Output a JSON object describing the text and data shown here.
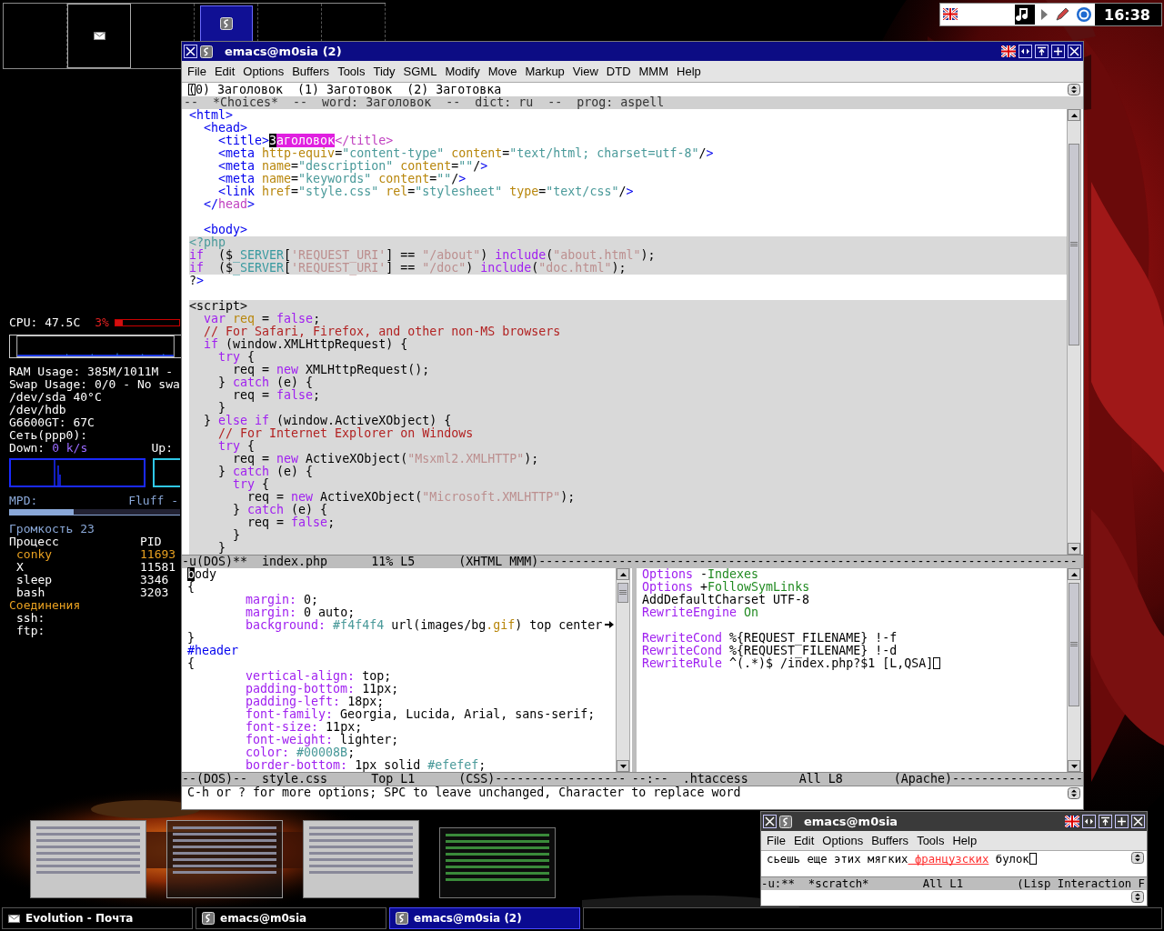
{
  "pager": [
    {
      "kind": "empty"
    },
    {
      "kind": "mail"
    },
    {
      "kind": "empty"
    },
    {
      "kind": "emacs"
    },
    {
      "kind": "empty"
    },
    {
      "kind": "empty"
    }
  ],
  "tray": {
    "clock": "16:38"
  },
  "conky": {
    "cpu": {
      "label": "CPU: 47.5C",
      "usage": "3%",
      "level": 0.12
    },
    "stats": [
      "RAM Usage: 385M/1011M -",
      "Swap Usage: 0/0 - No swa",
      "/dev/sda 40°C",
      "/dev/hdb",
      "G6600GT: 67C",
      "Сеть(ppp0):"
    ],
    "net": {
      "down_label": "Down:",
      "down": "0 k/s",
      "up_label": "Up:"
    },
    "mpd": {
      "label": "MPD:",
      "track": "Fluff -",
      "level": 0.38
    },
    "volume": "Громкость 23",
    "process_headers": [
      "Процесс",
      "PID"
    ],
    "processes": [
      {
        "name": "conky",
        "pid": "11693",
        "highlighted": true
      },
      {
        "name": "X",
        "pid": "11581",
        "highlighted": false
      },
      {
        "name": "sleep",
        "pid": "3346",
        "highlighted": false
      },
      {
        "name": "bash",
        "pid": "3203",
        "highlighted": false
      }
    ],
    "connections_title": "Соединения",
    "connections": [
      "ssh:",
      "ftp:"
    ]
  },
  "main_window": {
    "title": "emacs@m0sia (2)",
    "menu": [
      "File",
      "Edit",
      "Options",
      "Buffers",
      "Tools",
      "Tidy",
      "SGML",
      "Modify",
      "Move",
      "Markup",
      "View",
      "DTD",
      "MMM",
      "Help"
    ],
    "choices": [
      "(0) Заголовок",
      "(1) Заготовок",
      "(2) Заготовка"
    ],
    "header_line": "--  *Choices*  --  word: Заголовок  --  dict: ru  --  prog: aspell",
    "buffer": [
      {
        "kind": "code",
        "highlighted": false,
        "segments": [
          {
            "kind": "tag",
            "text": "<html>"
          }
        ]
      },
      {
        "kind": "code",
        "highlighted": false,
        "segments": [
          {
            "kind": "tag",
            "text": "  <head>"
          }
        ]
      },
      {
        "kind": "code",
        "highlighted": false,
        "segments": [
          {
            "kind": "tag",
            "text": "    <title>"
          },
          {
            "kind": "cursor",
            "text": "З"
          },
          {
            "kind": "match",
            "text": "аголовок"
          },
          {
            "kind": "close",
            "text": "</title>"
          }
        ]
      },
      {
        "kind": "code",
        "highlighted": false,
        "segments": [
          {
            "kind": "tag",
            "text": "    <meta"
          },
          {
            "kind": "attr",
            "text": " http-equiv"
          },
          {
            "kind": "plain",
            "text": "="
          },
          {
            "kind": "value",
            "text": "\"content-type\""
          },
          {
            "kind": "attr",
            "text": " content"
          },
          {
            "kind": "plain",
            "text": "="
          },
          {
            "kind": "value",
            "text": "\"text/html; charset=utf-8\""
          },
          {
            "kind": "plain",
            "text": "/"
          },
          {
            "kind": "tag",
            "text": ">"
          }
        ]
      },
      {
        "kind": "code",
        "highlighted": false,
        "segments": [
          {
            "kind": "tag",
            "text": "    <meta"
          },
          {
            "kind": "attr",
            "text": " name"
          },
          {
            "kind": "plain",
            "text": "="
          },
          {
            "kind": "value",
            "text": "\"description\""
          },
          {
            "kind": "attr",
            "text": " content"
          },
          {
            "kind": "plain",
            "text": "="
          },
          {
            "kind": "value",
            "text": "\"\""
          },
          {
            "kind": "plain",
            "text": "/"
          },
          {
            "kind": "tag",
            "text": ">"
          }
        ]
      },
      {
        "kind": "code",
        "highlighted": false,
        "segments": [
          {
            "kind": "tag",
            "text": "    <meta"
          },
          {
            "kind": "attr",
            "text": " name"
          },
          {
            "kind": "plain",
            "text": "="
          },
          {
            "kind": "value",
            "text": "\"keywords\""
          },
          {
            "kind": "attr",
            "text": " content"
          },
          {
            "kind": "plain",
            "text": "="
          },
          {
            "kind": "value",
            "text": "\"\""
          },
          {
            "kind": "plain",
            "text": "/"
          },
          {
            "kind": "tag",
            "text": ">"
          }
        ]
      },
      {
        "kind": "code",
        "highlighted": false,
        "segments": [
          {
            "kind": "tag",
            "text": "    <link"
          },
          {
            "kind": "attr",
            "text": " href"
          },
          {
            "kind": "plain",
            "text": "="
          },
          {
            "kind": "value",
            "text": "\"style.css\""
          },
          {
            "kind": "attr",
            "text": " rel"
          },
          {
            "kind": "plain",
            "text": "="
          },
          {
            "kind": "value",
            "text": "\"stylesheet\""
          },
          {
            "kind": "attr",
            "text": " type"
          },
          {
            "kind": "plain",
            "text": "="
          },
          {
            "kind": "value",
            "text": "\"text/css\""
          },
          {
            "kind": "plain",
            "text": "/"
          },
          {
            "kind": "tag",
            "text": ">"
          }
        ]
      },
      {
        "kind": "code",
        "highlighted": false,
        "segments": [
          {
            "kind": "tag",
            "text": "  </"
          },
          {
            "kind": "close",
            "text": "head"
          },
          {
            "kind": "tag",
            "text": ">"
          }
        ]
      },
      {
        "kind": "blank"
      },
      {
        "kind": "code",
        "highlighted": false,
        "segments": [
          {
            "kind": "tag",
            "text": "  <body>"
          }
        ]
      },
      {
        "kind": "code",
        "highlighted": true,
        "segments": [
          {
            "kind": "value",
            "text": "<?php"
          }
        ]
      },
      {
        "kind": "code",
        "highlighted": true,
        "segments": [
          {
            "kind": "keyword",
            "text": "if"
          },
          {
            "kind": "plain",
            "text": "  ($"
          },
          {
            "kind": "var",
            "text": "_SERVER"
          },
          {
            "kind": "plain",
            "text": "["
          },
          {
            "kind": "str",
            "text": "'REQUEST_URI'"
          },
          {
            "kind": "plain",
            "text": "] == "
          },
          {
            "kind": "str",
            "text": "\"/about\""
          },
          {
            "kind": "plain",
            "text": ")"
          },
          {
            "kind": "keyword",
            "text": " include"
          },
          {
            "kind": "plain",
            "text": "("
          },
          {
            "kind": "str",
            "text": "\"about.html\""
          },
          {
            "kind": "plain",
            "text": ");"
          }
        ]
      },
      {
        "kind": "code",
        "highlighted": true,
        "segments": [
          {
            "kind": "keyword",
            "text": "if"
          },
          {
            "kind": "plain",
            "text": "  ($"
          },
          {
            "kind": "var",
            "text": "_SERVER"
          },
          {
            "kind": "plain",
            "text": "["
          },
          {
            "kind": "str",
            "text": "'REQUEST_URI'"
          },
          {
            "kind": "plain",
            "text": "] == "
          },
          {
            "kind": "str",
            "text": "\"/doc\""
          },
          {
            "kind": "plain",
            "text": ")"
          },
          {
            "kind": "keyword",
            "text": " include"
          },
          {
            "kind": "plain",
            "text": "("
          },
          {
            "kind": "str",
            "text": "\"doc.html\""
          },
          {
            "kind": "plain",
            "text": ");"
          }
        ]
      },
      {
        "kind": "code",
        "highlighted": false,
        "segments": [
          {
            "kind": "plain",
            "text": "?"
          },
          {
            "kind": "tag",
            "text": ">"
          }
        ]
      },
      {
        "kind": "blank"
      },
      {
        "kind": "code",
        "highlighted": true,
        "segments": [
          {
            "kind": "plain",
            "text": "<script>"
          }
        ]
      },
      {
        "kind": "code",
        "highlighted": true,
        "segments": [
          {
            "kind": "keyword",
            "text": "  var"
          },
          {
            "kind": "attr",
            "text": " req"
          },
          {
            "kind": "plain",
            "text": " ="
          },
          {
            "kind": "keyword",
            "text": " false"
          },
          {
            "kind": "plain",
            "text": ";"
          }
        ]
      },
      {
        "kind": "code",
        "highlighted": true,
        "segments": [
          {
            "kind": "comment",
            "text": "  // For Safari, Firefox, and other non-MS browsers"
          }
        ]
      },
      {
        "kind": "code",
        "highlighted": true,
        "segments": [
          {
            "kind": "keyword",
            "text": "  if"
          },
          {
            "kind": "plain",
            "text": " (window.XMLHttpRequest) {"
          }
        ]
      },
      {
        "kind": "code",
        "highlighted": true,
        "segments": [
          {
            "kind": "keyword",
            "text": "    try"
          },
          {
            "kind": "plain",
            "text": " {"
          }
        ]
      },
      {
        "kind": "code",
        "highlighted": true,
        "segments": [
          {
            "kind": "plain",
            "text": "      req ="
          },
          {
            "kind": "keyword",
            "text": " new"
          },
          {
            "kind": "plain",
            "text": " XMLHttpRequest();"
          }
        ]
      },
      {
        "kind": "code",
        "highlighted": true,
        "segments": [
          {
            "kind": "plain",
            "text": "    }"
          },
          {
            "kind": "keyword",
            "text": " catch"
          },
          {
            "kind": "plain",
            "text": " (e) {"
          }
        ]
      },
      {
        "kind": "code",
        "highlighted": true,
        "segments": [
          {
            "kind": "plain",
            "text": "      req ="
          },
          {
            "kind": "keyword",
            "text": " false"
          },
          {
            "kind": "plain",
            "text": ";"
          }
        ]
      },
      {
        "kind": "code",
        "highlighted": true,
        "segments": [
          {
            "kind": "plain",
            "text": "    }"
          }
        ]
      },
      {
        "kind": "code",
        "highlighted": true,
        "segments": [
          {
            "kind": "plain",
            "text": "  }"
          },
          {
            "kind": "keyword",
            "text": " else if"
          },
          {
            "kind": "plain",
            "text": " (window.ActiveXObject) {"
          }
        ]
      },
      {
        "kind": "code",
        "highlighted": true,
        "segments": [
          {
            "kind": "comment",
            "text": "    // For Internet Explorer on Windows"
          }
        ]
      },
      {
        "kind": "code",
        "highlighted": true,
        "segments": [
          {
            "kind": "keyword",
            "text": "    try"
          },
          {
            "kind": "plain",
            "text": " {"
          }
        ]
      },
      {
        "kind": "code",
        "highlighted": true,
        "segments": [
          {
            "kind": "plain",
            "text": "      req ="
          },
          {
            "kind": "keyword",
            "text": " new"
          },
          {
            "kind": "plain",
            "text": " ActiveXObject("
          },
          {
            "kind": "str",
            "text": "\"Msxml2.XMLHTTP\""
          },
          {
            "kind": "plain",
            "text": ");"
          }
        ]
      },
      {
        "kind": "code",
        "highlighted": true,
        "segments": [
          {
            "kind": "plain",
            "text": "    }"
          },
          {
            "kind": "keyword",
            "text": " catch"
          },
          {
            "kind": "plain",
            "text": " (e) {"
          }
        ]
      },
      {
        "kind": "code",
        "highlighted": true,
        "segments": [
          {
            "kind": "keyword",
            "text": "      try"
          },
          {
            "kind": "plain",
            "text": " {"
          }
        ]
      },
      {
        "kind": "code",
        "highlighted": true,
        "segments": [
          {
            "kind": "plain",
            "text": "        req ="
          },
          {
            "kind": "keyword",
            "text": " new"
          },
          {
            "kind": "plain",
            "text": " ActiveXObject("
          },
          {
            "kind": "str",
            "text": "\"Microsoft.XMLHTTP\""
          },
          {
            "kind": "plain",
            "text": ");"
          }
        ]
      },
      {
        "kind": "code",
        "highlighted": true,
        "segments": [
          {
            "kind": "plain",
            "text": "      }"
          },
          {
            "kind": "keyword",
            "text": " catch"
          },
          {
            "kind": "plain",
            "text": " (e) {"
          }
        ]
      },
      {
        "kind": "code",
        "highlighted": true,
        "segments": [
          {
            "kind": "plain",
            "text": "        req ="
          },
          {
            "kind": "keyword",
            "text": " false"
          },
          {
            "kind": "plain",
            "text": ";"
          }
        ]
      },
      {
        "kind": "code",
        "highlighted": true,
        "segments": [
          {
            "kind": "plain",
            "text": "      }"
          }
        ]
      },
      {
        "kind": "code",
        "highlighted": true,
        "segments": [
          {
            "kind": "plain",
            "text": "    }"
          }
        ]
      }
    ],
    "mode_line": "-u(DOS)**  index.php      11% L5      (XHTML MMM)--------------------------------------------------------------------------",
    "left_pane": [
      {
        "kind": "code",
        "highlighted": false,
        "segments": [
          {
            "kind": "cursor",
            "text": "b"
          },
          {
            "kind": "plain",
            "text": "ody"
          }
        ]
      },
      {
        "kind": "code",
        "highlighted": false,
        "segments": [
          {
            "kind": "plain",
            "text": "{"
          }
        ]
      },
      {
        "kind": "code",
        "highlighted": false,
        "segments": [
          {
            "kind": "keyword",
            "text": "        margin:"
          },
          {
            "kind": "plain",
            "text": " 0;"
          }
        ]
      },
      {
        "kind": "code",
        "highlighted": false,
        "segments": [
          {
            "kind": "keyword",
            "text": "        margin:"
          },
          {
            "kind": "plain",
            "text": " 0 auto;"
          }
        ]
      },
      {
        "kind": "code",
        "highlighted": false,
        "continued": true,
        "segments": [
          {
            "kind": "keyword",
            "text": "        background:"
          },
          {
            "kind": "value",
            "text": " #f4f4f4"
          },
          {
            "kind": "plain",
            "text": " url(images/bg"
          },
          {
            "kind": "attr",
            "text": ".gif"
          },
          {
            "kind": "plain",
            "text": ") top center"
          }
        ]
      },
      {
        "kind": "code",
        "highlighted": false,
        "segments": [
          {
            "kind": "plain",
            "text": "}"
          }
        ]
      },
      {
        "kind": "code",
        "highlighted": false,
        "segments": [
          {
            "kind": "tag",
            "text": "#header"
          }
        ]
      },
      {
        "kind": "code",
        "highlighted": false,
        "segments": [
          {
            "kind": "plain",
            "text": "{"
          }
        ]
      },
      {
        "kind": "code",
        "highlighted": false,
        "segments": [
          {
            "kind": "keyword",
            "text": "        vertical-align:"
          },
          {
            "kind": "plain",
            "text": " top;"
          }
        ]
      },
      {
        "kind": "code",
        "highlighted": false,
        "segments": [
          {
            "kind": "keyword",
            "text": "        padding-bottom:"
          },
          {
            "kind": "plain",
            "text": " 11px;"
          }
        ]
      },
      {
        "kind": "code",
        "highlighted": false,
        "segments": [
          {
            "kind": "keyword",
            "text": "        padding-left:"
          },
          {
            "kind": "plain",
            "text": " 18px;"
          }
        ]
      },
      {
        "kind": "code",
        "highlighted": false,
        "segments": [
          {
            "kind": "keyword",
            "text": "        font-family:"
          },
          {
            "kind": "plain",
            "text": " Georgia, Lucida, Arial, sans-serif;"
          }
        ]
      },
      {
        "kind": "code",
        "highlighted": false,
        "segments": [
          {
            "kind": "keyword",
            "text": "        font-size:"
          },
          {
            "kind": "plain",
            "text": " 11px;"
          }
        ]
      },
      {
        "kind": "code",
        "highlighted": false,
        "segments": [
          {
            "kind": "keyword",
            "text": "        font-weight:"
          },
          {
            "kind": "plain",
            "text": " lighter;"
          }
        ]
      },
      {
        "kind": "code",
        "highlighted": false,
        "segments": [
          {
            "kind": "keyword",
            "text": "        color:"
          },
          {
            "kind": "value",
            "text": " #00008B"
          },
          {
            "kind": "plain",
            "text": ";"
          }
        ]
      },
      {
        "kind": "code",
        "highlighted": false,
        "segments": [
          {
            "kind": "keyword",
            "text": "        border-bottom:"
          },
          {
            "kind": "plain",
            "text": " 1px solid"
          },
          {
            "kind": "value",
            "text": " #efefef"
          },
          {
            "kind": "plain",
            "text": ";"
          }
        ]
      }
    ],
    "right_pane": [
      {
        "kind": "code",
        "highlighted": false,
        "segments": [
          {
            "kind": "keyword",
            "text": "Options"
          },
          {
            "kind": "plain",
            "text": " -"
          },
          {
            "kind": "green",
            "text": "Indexes"
          }
        ]
      },
      {
        "kind": "code",
        "highlighted": false,
        "segments": [
          {
            "kind": "keyword",
            "text": "Options"
          },
          {
            "kind": "plain",
            "text": " +"
          },
          {
            "kind": "green",
            "text": "FollowSymLinks"
          }
        ]
      },
      {
        "kind": "code",
        "highlighted": false,
        "segments": [
          {
            "kind": "plain",
            "text": "AddDefaultCharset UTF-8"
          }
        ]
      },
      {
        "kind": "code",
        "highlighted": false,
        "segments": [
          {
            "kind": "keyword",
            "text": "RewriteEngine"
          },
          {
            "kind": "green",
            "text": " On"
          }
        ]
      },
      {
        "kind": "blank"
      },
      {
        "kind": "code",
        "highlighted": false,
        "segments": [
          {
            "kind": "keyword",
            "text": "RewriteCond"
          },
          {
            "kind": "plain",
            "text": " %{REQUEST_FILENAME} !-f"
          }
        ]
      },
      {
        "kind": "code",
        "highlighted": false,
        "segments": [
          {
            "kind": "keyword",
            "text": "RewriteCond"
          },
          {
            "kind": "plain",
            "text": " %{REQUEST_FILENAME} !-d"
          }
        ]
      },
      {
        "kind": "code",
        "highlighted": false,
        "cursor_at_end": true,
        "segments": [
          {
            "kind": "keyword",
            "text": "RewriteRule"
          },
          {
            "kind": "plain",
            "text": " ^(.*)$ /index.php?$1 [L,QSA]"
          }
        ]
      }
    ],
    "left_mode_line": "--(DOS)--  style.css      Top L1      (CSS)------------------",
    "right_mode_line": "--:--  .htaccess       All L8       (Apache)------------------",
    "echo_area": "C-h or ? for more options; SPC to leave unchanged, Character to replace word"
  },
  "thumbnails": [
    {
      "kind": "light"
    },
    {
      "kind": "dark"
    },
    {
      "kind": "light"
    },
    {
      "kind": "terminal"
    }
  ],
  "small_window": {
    "title": "emacs@m0sia",
    "menu": [
      "File",
      "Edit",
      "Options",
      "Buffers",
      "Tools",
      "Help"
    ],
    "line": {
      "kind": "code",
      "highlighted": false,
      "cursor_at_end": true,
      "segments": [
        {
          "kind": "plain",
          "text": "сьешь еще этих мягких"
        },
        {
          "kind": "misspelled",
          "text": " французских"
        },
        {
          "kind": "plain",
          "text": " булок"
        }
      ]
    },
    "mode_line": "-u:**  *scratch*        All L1        (Lisp Interaction F"
  },
  "taskbar": [
    {
      "label": "Evolution - Почта",
      "kind": "mail",
      "selected": false
    },
    {
      "label": "emacs@m0sia",
      "kind": "emacs",
      "selected": false
    },
    {
      "label": "emacs@m0sia (2)",
      "kind": "emacs",
      "selected": true
    }
  ]
}
